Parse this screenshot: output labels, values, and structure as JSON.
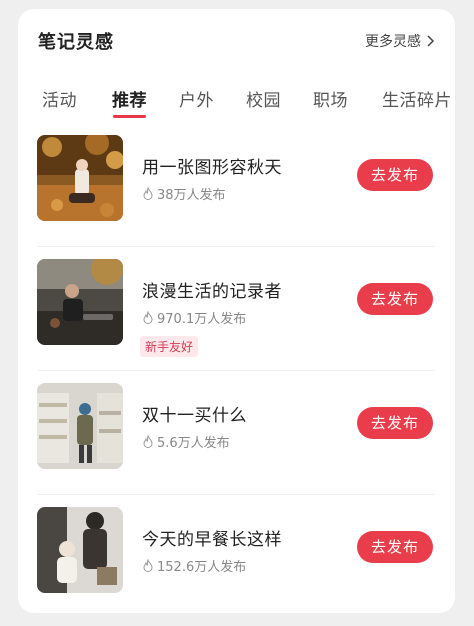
{
  "header": {
    "title": "笔记灵感",
    "more_label": "更多灵感"
  },
  "tabs": [
    {
      "label": "活动",
      "active": false
    },
    {
      "label": "推荐",
      "active": true
    },
    {
      "label": "户外",
      "active": false
    },
    {
      "label": "校园",
      "active": false
    },
    {
      "label": "职场",
      "active": false
    },
    {
      "label": "生活碎片",
      "active": false
    }
  ],
  "items": [
    {
      "title": "用一张图形容秋天",
      "count": "38万人发布",
      "badge": "",
      "button": "去发布",
      "thumb_icon": "autumn-photo"
    },
    {
      "title": "浪漫生活的记录者",
      "count": "970.1万人发布",
      "badge": "新手友好",
      "button": "去发布",
      "thumb_icon": "picnic-photo"
    },
    {
      "title": "双十一买什么",
      "count": "5.6万人发布",
      "badge": "",
      "button": "去发布",
      "thumb_icon": "supermarket-photo"
    },
    {
      "title": "今天的早餐长这样",
      "count": "152.6万人发布",
      "badge": "",
      "button": "去发布",
      "thumb_icon": "family-photo"
    }
  ],
  "colors": {
    "accent": "#e93d4b",
    "badge_bg": "#fde9ec",
    "badge_text": "#d83a52"
  }
}
